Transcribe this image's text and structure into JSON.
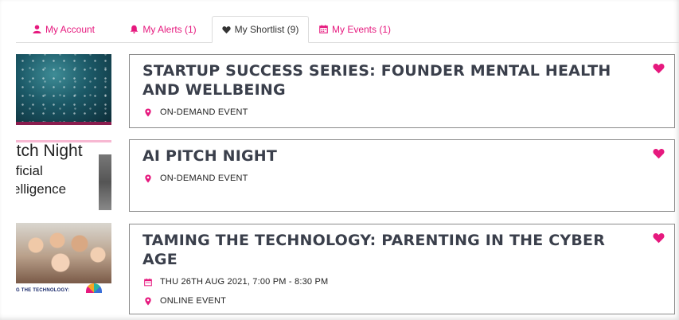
{
  "colors": {
    "accent": "#e6197e",
    "title": "#3a3f4b",
    "border": "#8a8a8a"
  },
  "tabs": [
    {
      "label": "My Account",
      "icon": "user-icon",
      "active": false
    },
    {
      "label": "My Alerts (1)",
      "icon": "bell-icon",
      "active": false
    },
    {
      "label": "My Shortlist (9)",
      "icon": "heart-icon",
      "active": true
    },
    {
      "label": "My Events (1)",
      "icon": "calendar-icon",
      "active": false
    }
  ],
  "events": [
    {
      "title": "STARTUP SUCCESS SERIES: FOUNDER MENTAL HEALTH AND WELLBEING",
      "location": "ON-DEMAND EVENT",
      "shortlisted": true
    },
    {
      "title": "AI PITCH NIGHT",
      "location": "ON-DEMAND EVENT",
      "shortlisted": true,
      "thumb_lines": [
        "itch Night",
        "ificial",
        "elligence"
      ]
    },
    {
      "title": "TAMING THE TECHNOLOGY: PARENTING IN THE CYBER AGE",
      "datetime": "THU 26TH AUG 2021, 7:00 PM - 8:30 PM",
      "location": "ONLINE EVENT",
      "shortlisted": true,
      "thumb_caption": "G THE TECHNOLOGY:"
    }
  ]
}
